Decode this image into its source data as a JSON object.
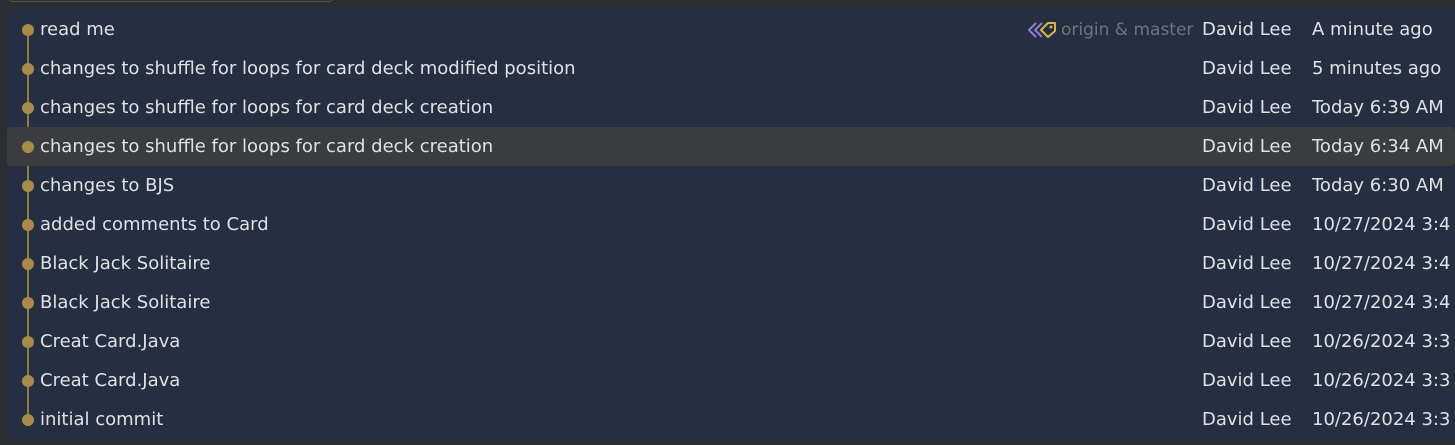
{
  "graph": {
    "node_color": "#a88a4c",
    "line_color": "#8f7a46"
  },
  "commits": [
    {
      "message": "read me",
      "refs": "origin & master",
      "author": "David Lee",
      "date": "A minute ago",
      "selected": false
    },
    {
      "message": "changes to shuffle for loops for card deck modified position",
      "refs": "",
      "author": "David Lee",
      "date": "5 minutes ago",
      "selected": false
    },
    {
      "message": "changes to shuffle for loops for card deck creation",
      "refs": "",
      "author": "David Lee",
      "date": "Today 6:39 AM",
      "selected": false
    },
    {
      "message": "changes to shuffle for loops for card deck creation",
      "refs": "",
      "author": "David Lee",
      "date": "Today 6:34 AM",
      "selected": true
    },
    {
      "message": "changes to BJS",
      "refs": "",
      "author": "David Lee",
      "date": "Today 6:30 AM",
      "selected": false
    },
    {
      "message": "added comments to Card",
      "refs": "",
      "author": "David Lee",
      "date": "10/27/2024 3:4",
      "selected": false
    },
    {
      "message": "Black Jack Solitaire",
      "refs": "",
      "author": "David Lee",
      "date": "10/27/2024 3:4",
      "selected": false
    },
    {
      "message": "Black Jack Solitaire",
      "refs": "",
      "author": "David Lee",
      "date": "10/27/2024 3:4",
      "selected": false
    },
    {
      "message": "Creat Card.Java",
      "refs": "",
      "author": "David Lee",
      "date": "10/26/2024 3:3",
      "selected": false
    },
    {
      "message": "Creat Card.Java",
      "refs": "",
      "author": "David Lee",
      "date": "10/26/2024 3:3",
      "selected": false
    },
    {
      "message": "initial commit",
      "refs": "",
      "author": "David Lee",
      "date": "10/26/2024 3:3",
      "selected": false
    }
  ]
}
